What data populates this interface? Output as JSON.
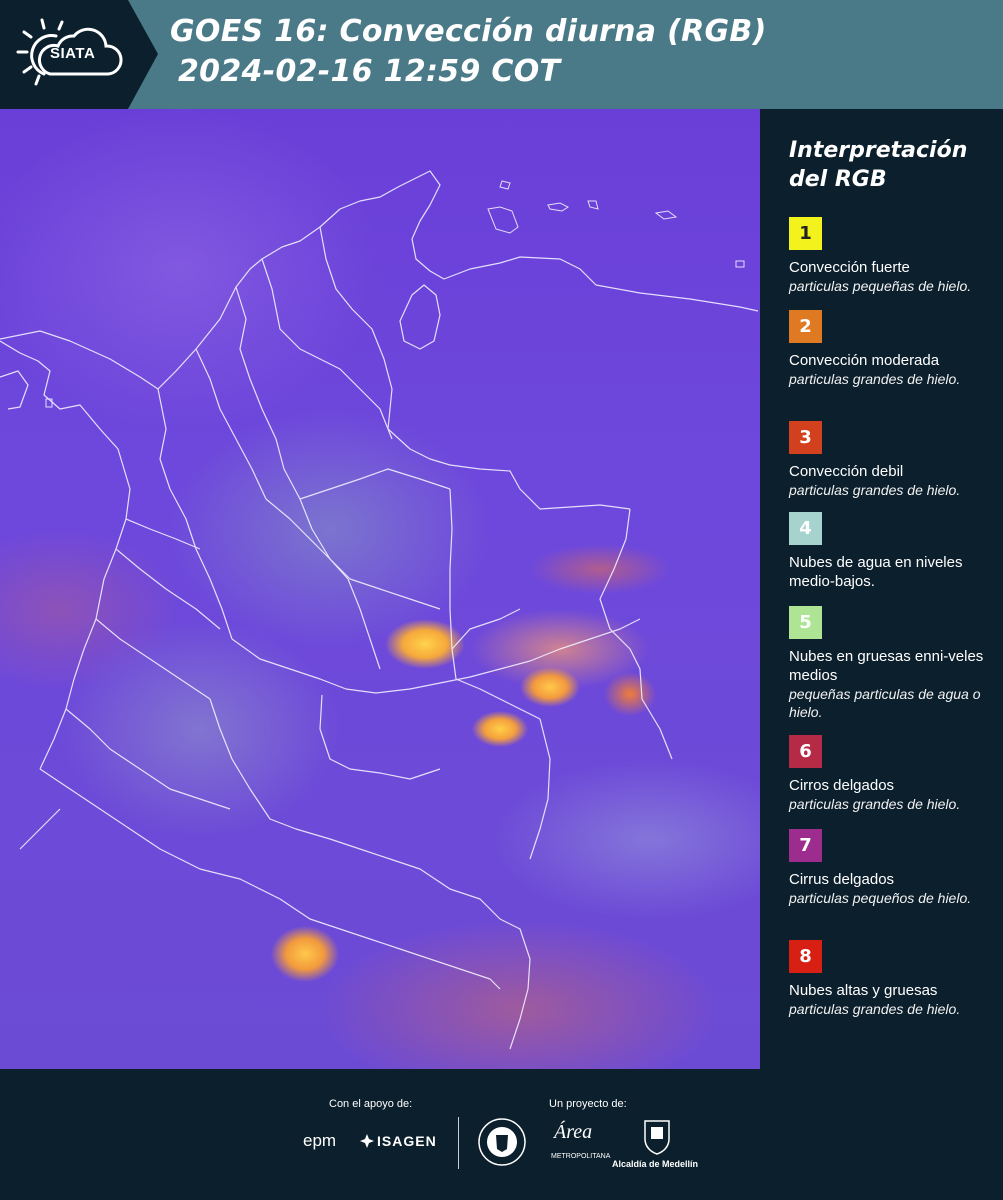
{
  "header": {
    "logo_text": "SIATA",
    "title_line1": "GOES 16: Convección diurna (RGB)",
    "title_line2": "2024-02-16 12:59 COT"
  },
  "legend": {
    "title_line1": "Interpretación",
    "title_line2": "del RGB",
    "items": [
      {
        "number": "1",
        "color": "#f4f21c",
        "text_color": "#222222",
        "label": "Convección fuerte",
        "sub": "particulas pequeñas de hielo."
      },
      {
        "number": "2",
        "color": "#e07a22",
        "text_color": "#ffffff",
        "label": "Convección moderada",
        "sub": "particulas grandes de hielo."
      },
      {
        "number": "3",
        "color": "#d2401e",
        "text_color": "#ffffff",
        "label": "Convección debil",
        "sub": "particulas grandes de hielo."
      },
      {
        "number": "4",
        "color": "#a6d3cd",
        "text_color": "#ffffff",
        "label": "Nubes de agua en niveles medio-bajos.",
        "sub": ""
      },
      {
        "number": "5",
        "color": "#aee594",
        "text_color": "#ffffff",
        "label": "Nubes en gruesas enni-veles medios",
        "sub": "pequeñas particulas de agua o hielo."
      },
      {
        "number": "6",
        "color": "#b52b45",
        "text_color": "#ffffff",
        "label": "Cirros delgados",
        "sub": "particulas grandes de hielo."
      },
      {
        "number": "7",
        "color": "#9c2d8e",
        "text_color": "#ffffff",
        "label": "Cirrus delgados",
        "sub": "particulas pequeños de hielo."
      },
      {
        "number": "8",
        "color": "#d81f14",
        "text_color": "#ffffff",
        "label": "Nubes altas y gruesas",
        "sub": "particulas grandes de hielo."
      }
    ]
  },
  "footer": {
    "support_label": "Con el apoyo de:",
    "project_label": "Un proyecto de:",
    "sponsor_epm": "epm",
    "sponsor_isagen": "ISAGEN",
    "area_metro_text": "Área",
    "area_metro_sub": "METROPOLITANA",
    "alcaldia_label": "Alcaldía de Medellín"
  }
}
